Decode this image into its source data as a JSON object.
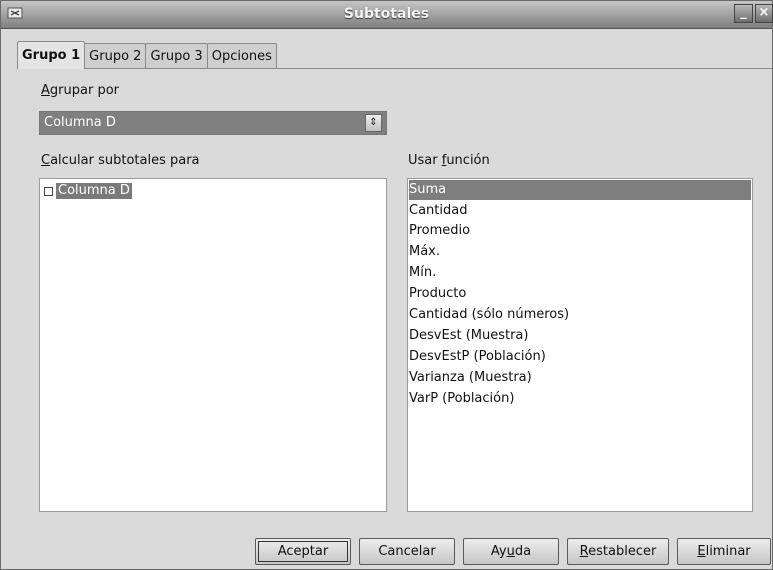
{
  "window": {
    "title": "Subtotales",
    "minimize_glyph": "_",
    "close_glyph": "×"
  },
  "tabs": [
    {
      "label": "Grupo 1",
      "active": true
    },
    {
      "label": "Grupo 2",
      "active": false
    },
    {
      "label": "Grupo 3",
      "active": false
    },
    {
      "label": "Opciones",
      "active": false
    }
  ],
  "group_by": {
    "label_mnemonic": "A",
    "label_rest": "grupar por",
    "selected_value": "Columna D",
    "arrow_glyph": "⇕"
  },
  "subtotals": {
    "label_mnemonic": "C",
    "label_rest": "alcular subtotales para",
    "columns": [
      {
        "label": "Columna D",
        "checked": false
      }
    ]
  },
  "functions": {
    "label_prefix": "Usar ",
    "label_mnemonic": "f",
    "label_rest": "unción",
    "items": [
      {
        "label": "Suma",
        "selected": true
      },
      {
        "label": "Cantidad",
        "selected": false
      },
      {
        "label": "Promedio",
        "selected": false
      },
      {
        "label": "Máx.",
        "selected": false
      },
      {
        "label": "Mín.",
        "selected": false
      },
      {
        "label": "Producto",
        "selected": false
      },
      {
        "label": "Cantidad (sólo números)",
        "selected": false
      },
      {
        "label": "DesvEst (Muestra)",
        "selected": false
      },
      {
        "label": "DesvEstP (Población)",
        "selected": false
      },
      {
        "label": "Varianza (Muestra)",
        "selected": false
      },
      {
        "label": "VarP (Población)",
        "selected": false
      }
    ]
  },
  "buttons": {
    "ok": "Aceptar",
    "cancel": "Cancelar",
    "help_pre": "Ay",
    "help_mnemonic": "u",
    "help_post": "da",
    "reset_mnemonic": "R",
    "reset_rest": "establecer",
    "delete_mnemonic": "E",
    "delete_rest": "liminar"
  },
  "colors": {
    "selection": "#7e7e7e",
    "dialog_bg": "#dadada"
  }
}
